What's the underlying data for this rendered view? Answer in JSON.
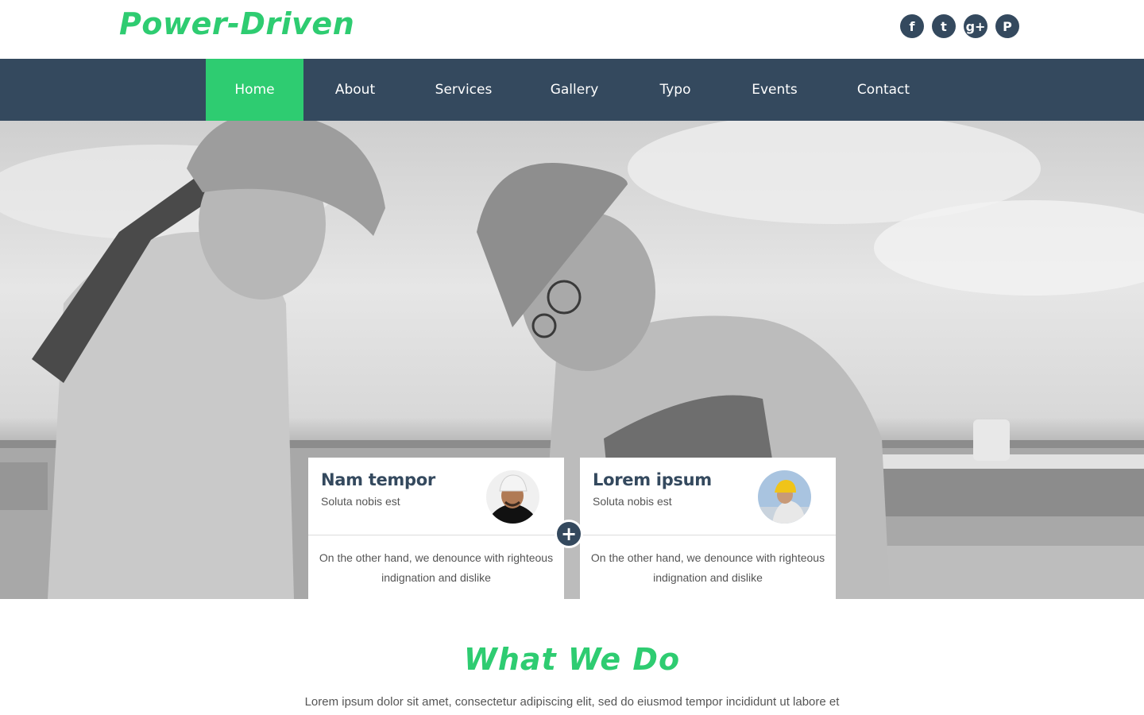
{
  "brand": {
    "logo": "Power-Driven"
  },
  "social": [
    {
      "icon": "facebook-icon",
      "glyph": "f"
    },
    {
      "icon": "twitter-icon",
      "glyph": "t"
    },
    {
      "icon": "google-plus-icon",
      "glyph": "g+"
    },
    {
      "icon": "pinterest-icon",
      "glyph": "P"
    }
  ],
  "nav": {
    "items": [
      {
        "label": "Home",
        "active": true
      },
      {
        "label": "About"
      },
      {
        "label": "Services"
      },
      {
        "label": "Gallery"
      },
      {
        "label": "Typo"
      },
      {
        "label": "Events"
      },
      {
        "label": "Contact"
      }
    ]
  },
  "cards": [
    {
      "title": "Nam tempor",
      "subtitle": "Soluta nobis est",
      "text": "On the other hand, we denounce with righteous indignation and dislike"
    },
    {
      "title": "Lorem ipsum",
      "subtitle": "Soluta nobis est",
      "text": "On the other hand, we denounce with righteous indignation and dislike"
    }
  ],
  "plus_glyph": "+",
  "what_we_do": {
    "title": "What We Do",
    "text": "Lorem ipsum dolor sit amet, consectetur adipiscing elit, sed do eiusmod tempor incididunt ut labore et"
  },
  "colors": {
    "accent": "#2ecc71",
    "dark": "#34495e"
  }
}
